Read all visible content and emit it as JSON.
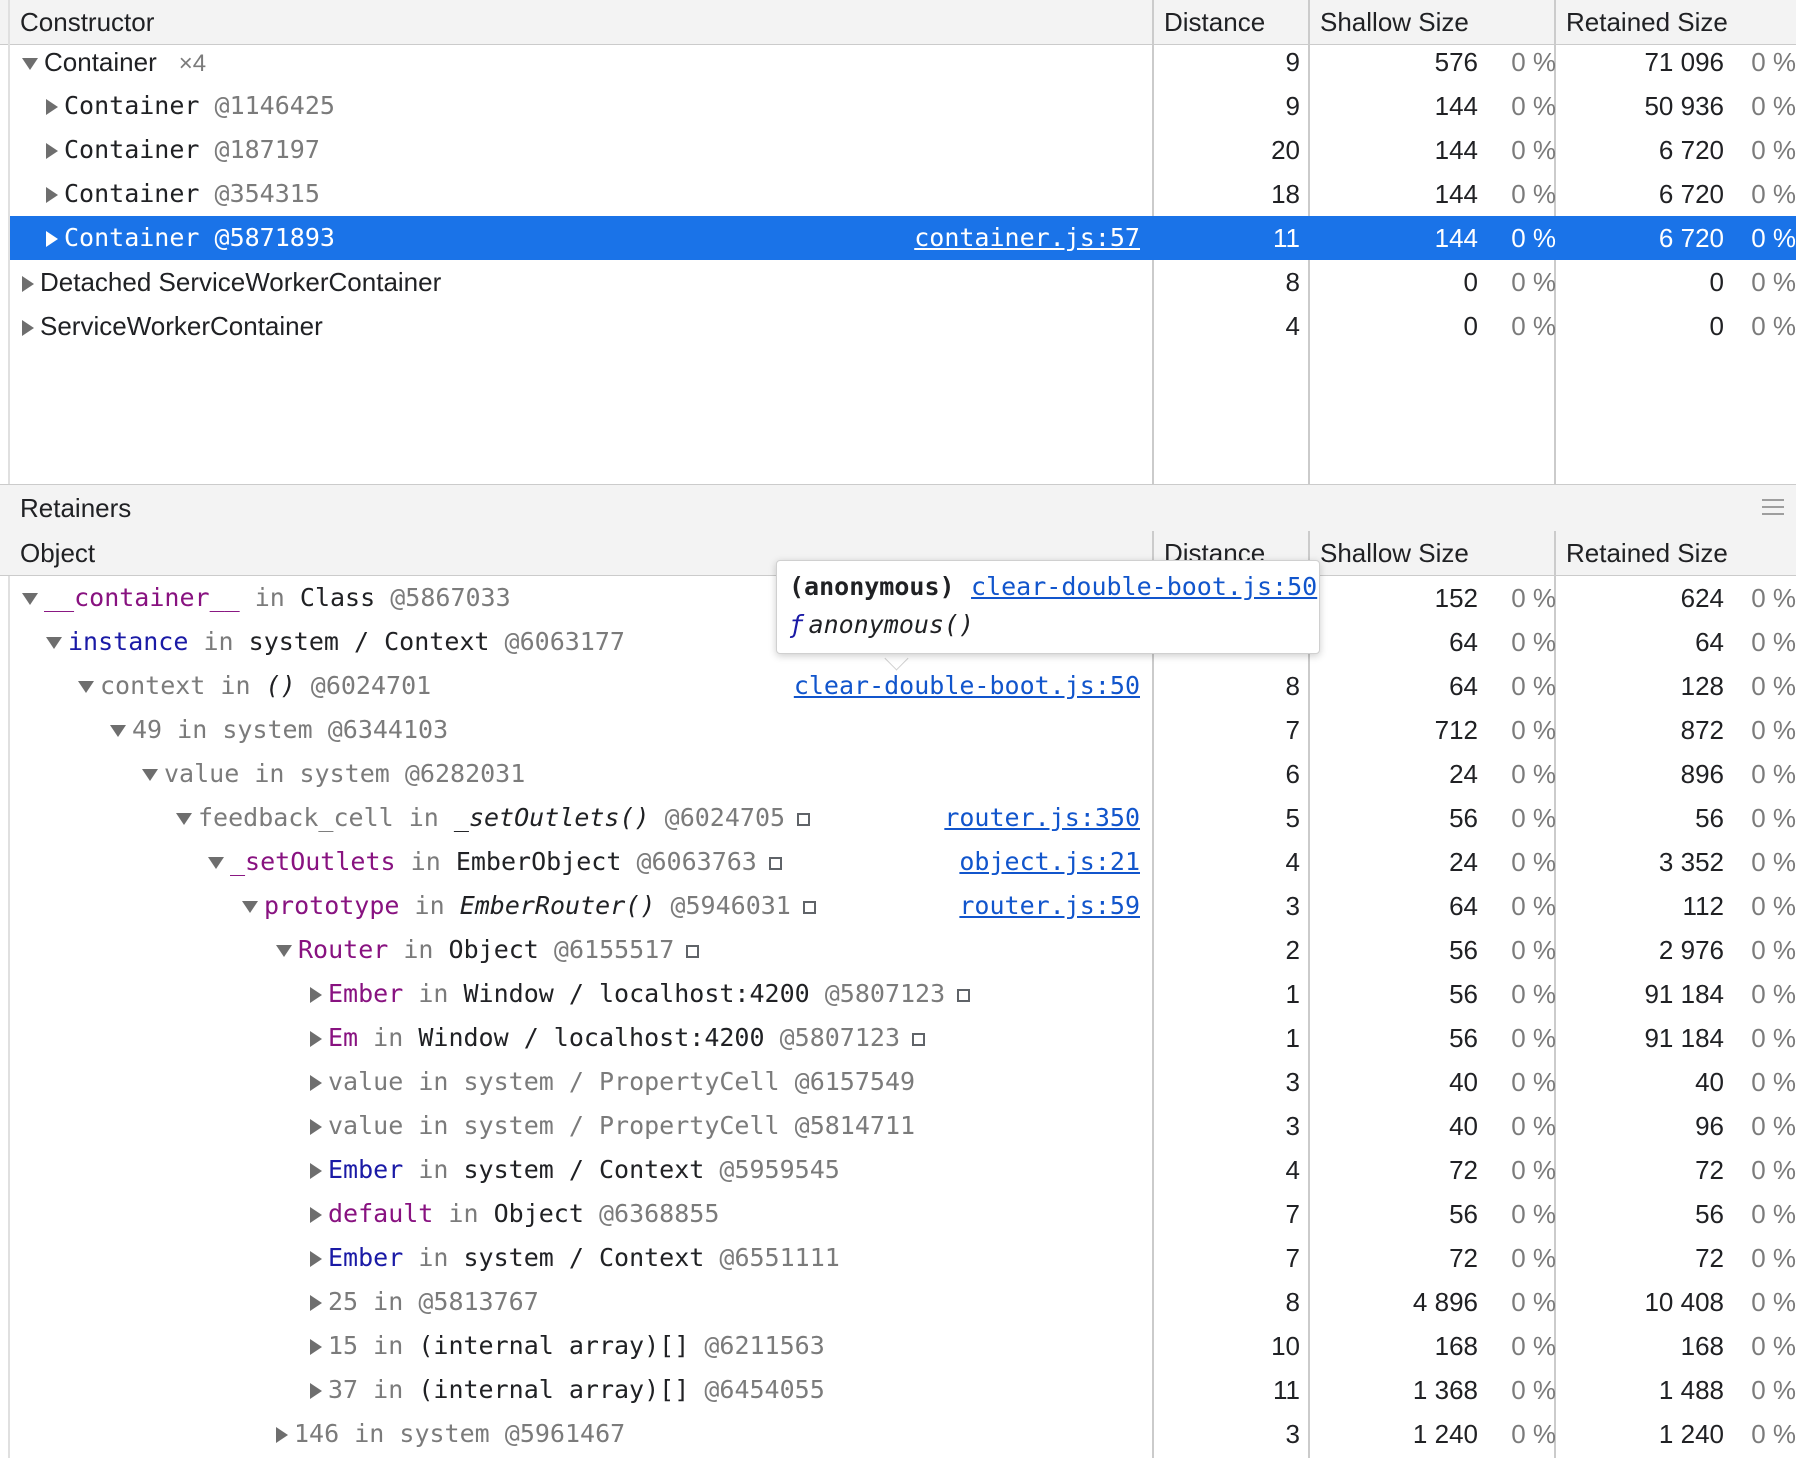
{
  "top": {
    "headers": {
      "constructor": "Constructor",
      "distance": "Distance",
      "shallow": "Shallow Size",
      "retained": "Retained Size"
    },
    "rows": [
      {
        "name": "Container",
        "count": "×4",
        "distance": "9",
        "shallow": "576",
        "shallow_pct": "0 %",
        "retained": "71 096",
        "retained_pct": "0 %"
      },
      {
        "name": "Container",
        "id": "@1146425",
        "distance": "9",
        "shallow": "144",
        "shallow_pct": "0 %",
        "retained": "50 936",
        "retained_pct": "0 %"
      },
      {
        "name": "Container",
        "id": "@187197",
        "distance": "20",
        "shallow": "144",
        "shallow_pct": "0 %",
        "retained": "6 720",
        "retained_pct": "0 %"
      },
      {
        "name": "Container",
        "id": "@354315",
        "distance": "18",
        "shallow": "144",
        "shallow_pct": "0 %",
        "retained": "6 720",
        "retained_pct": "0 %"
      },
      {
        "name": "Container",
        "id": "@5871893",
        "link": "container.js:57",
        "distance": "11",
        "shallow": "144",
        "shallow_pct": "0 %",
        "retained": "6 720",
        "retained_pct": "0 %"
      },
      {
        "name": "Detached ServiceWorkerContainer",
        "distance": "8",
        "shallow": "0",
        "shallow_pct": "0 %",
        "retained": "0",
        "retained_pct": "0 %"
      },
      {
        "name": "ServiceWorkerContainer",
        "distance": "4",
        "shallow": "0",
        "shallow_pct": "0 %",
        "retained": "0",
        "retained_pct": "0 %"
      }
    ]
  },
  "retainers": {
    "title": "Retainers",
    "headers": {
      "object": "Object",
      "distance": "Distance",
      "shallow": "Shallow Size",
      "retained": "Retained Size"
    },
    "rows": [
      {
        "prop": "__container__",
        "in": "in",
        "type": "Class",
        "id": "@5867033",
        "distance": "",
        "shallow": "152",
        "shallow_pct": "0 %",
        "retained": "624",
        "retained_pct": "0 %"
      },
      {
        "prop": "instance",
        "in": "in",
        "type": "system / Context",
        "id": "@6063177",
        "distance": "",
        "shallow": "64",
        "shallow_pct": "0 %",
        "retained": "64",
        "retained_pct": "0 %"
      },
      {
        "prop": "context",
        "in": "in",
        "type": "()",
        "id": "@6024701",
        "link": "clear-double-boot.js:50",
        "distance": "8",
        "shallow": "64",
        "shallow_pct": "0 %",
        "retained": "128",
        "retained_pct": "0 %"
      },
      {
        "prop": "49",
        "in": "in",
        "type": "system",
        "id": "@6344103",
        "distance": "7",
        "shallow": "712",
        "shallow_pct": "0 %",
        "retained": "872",
        "retained_pct": "0 %"
      },
      {
        "prop": "value",
        "in": "in",
        "type": "system",
        "id": "@6282031",
        "distance": "6",
        "shallow": "24",
        "shallow_pct": "0 %",
        "retained": "896",
        "retained_pct": "0 %"
      },
      {
        "prop": "feedback_cell",
        "in": "in",
        "type": "_setOutlets()",
        "id": "@6024705",
        "link": "router.js:350",
        "distance": "5",
        "shallow": "56",
        "shallow_pct": "0 %",
        "retained": "56",
        "retained_pct": "0 %"
      },
      {
        "prop": "_setOutlets",
        "in": "in",
        "type": "EmberObject",
        "id": "@6063763",
        "link": "object.js:21",
        "distance": "4",
        "shallow": "24",
        "shallow_pct": "0 %",
        "retained": "3 352",
        "retained_pct": "0 %"
      },
      {
        "prop": "prototype",
        "in": "in",
        "type": "EmberRouter()",
        "id": "@5946031",
        "link": "router.js:59",
        "distance": "3",
        "shallow": "64",
        "shallow_pct": "0 %",
        "retained": "112",
        "retained_pct": "0 %"
      },
      {
        "prop": "Router",
        "in": "in",
        "type": "Object",
        "id": "@6155517",
        "distance": "2",
        "shallow": "56",
        "shallow_pct": "0 %",
        "retained": "2 976",
        "retained_pct": "0 %"
      },
      {
        "prop": "Ember",
        "in": "in",
        "type": "Window / localhost:4200",
        "id": "@5807123",
        "distance": "1",
        "shallow": "56",
        "shallow_pct": "0 %",
        "retained": "91 184",
        "retained_pct": "0 %"
      },
      {
        "prop": "Em",
        "in": "in",
        "type": "Window / localhost:4200",
        "id": "@5807123",
        "distance": "1",
        "shallow": "56",
        "shallow_pct": "0 %",
        "retained": "91 184",
        "retained_pct": "0 %"
      },
      {
        "prop": "value",
        "in": "in",
        "type": "system / PropertyCell",
        "id": "@6157549",
        "distance": "3",
        "shallow": "40",
        "shallow_pct": "0 %",
        "retained": "40",
        "retained_pct": "0 %"
      },
      {
        "prop": "value",
        "in": "in",
        "type": "system / PropertyCell",
        "id": "@5814711",
        "distance": "3",
        "shallow": "40",
        "shallow_pct": "0 %",
        "retained": "96",
        "retained_pct": "0 %"
      },
      {
        "prop": "Ember",
        "in": "in",
        "type": "system / Context",
        "id": "@5959545",
        "distance": "4",
        "shallow": "72",
        "shallow_pct": "0 %",
        "retained": "72",
        "retained_pct": "0 %"
      },
      {
        "prop": "default",
        "in": "in",
        "type": "Object",
        "id": "@6368855",
        "distance": "7",
        "shallow": "56",
        "shallow_pct": "0 %",
        "retained": "56",
        "retained_pct": "0 %"
      },
      {
        "prop": "Ember",
        "in": "in",
        "type": "system / Context",
        "id": "@6551111",
        "distance": "7",
        "shallow": "72",
        "shallow_pct": "0 %",
        "retained": "72",
        "retained_pct": "0 %"
      },
      {
        "prop": "25",
        "in": "in",
        "type": "",
        "id": "@5813767",
        "distance": "8",
        "shallow": "4 896",
        "shallow_pct": "0 %",
        "retained": "10 408",
        "retained_pct": "0 %"
      },
      {
        "prop": "15",
        "in": "in",
        "type": "(internal array)[]",
        "id": "@6211563",
        "distance": "10",
        "shallow": "168",
        "shallow_pct": "0 %",
        "retained": "168",
        "retained_pct": "0 %"
      },
      {
        "prop": "37",
        "in": "in",
        "type": "(internal array)[]",
        "id": "@6454055",
        "distance": "11",
        "shallow": "1 368",
        "shallow_pct": "0 %",
        "retained": "1 488",
        "retained_pct": "0 %"
      },
      {
        "prop": "146",
        "in": "in",
        "type": "system",
        "id": "@5961467",
        "distance": "3",
        "shallow": "1 240",
        "shallow_pct": "0 %",
        "retained": "1 240",
        "retained_pct": "0 %"
      }
    ]
  },
  "tooltip": {
    "name": "(anonymous)",
    "link": "clear-double-boot.js:50",
    "f": "ƒ",
    "signature": "anonymous()"
  }
}
